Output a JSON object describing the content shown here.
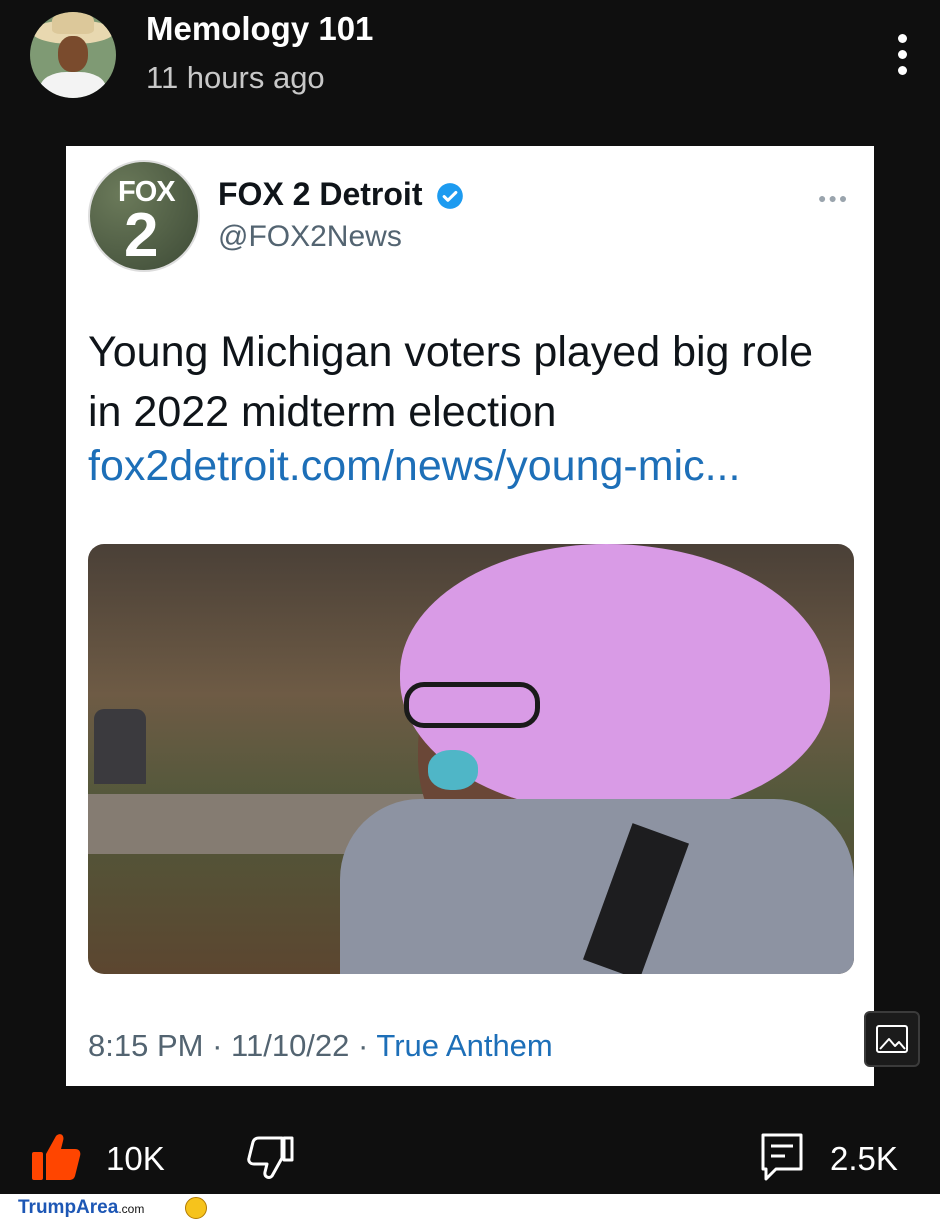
{
  "post": {
    "author": "Memology 101",
    "time": "11 hours ago"
  },
  "tweet": {
    "logo_text": "FOX",
    "logo_number": "2",
    "name": "FOX 2 Detroit",
    "handle": "@FOX2News",
    "text": "Young Michigan voters played big role in 2022 midterm election",
    "link": "fox2detroit.com/news/young-mic...",
    "time": "8:15 PM",
    "date": "11/10/22",
    "separator": "·",
    "app": "True Anthem"
  },
  "actions": {
    "like_count": "10K",
    "comment_count": "2.5K"
  },
  "footer": {
    "watermark": "TrumpArea",
    "watermark_suffix": ".com"
  },
  "colors": {
    "like": "#ff4500",
    "link": "#1d6fb8",
    "verified": "#1d9bf0"
  }
}
